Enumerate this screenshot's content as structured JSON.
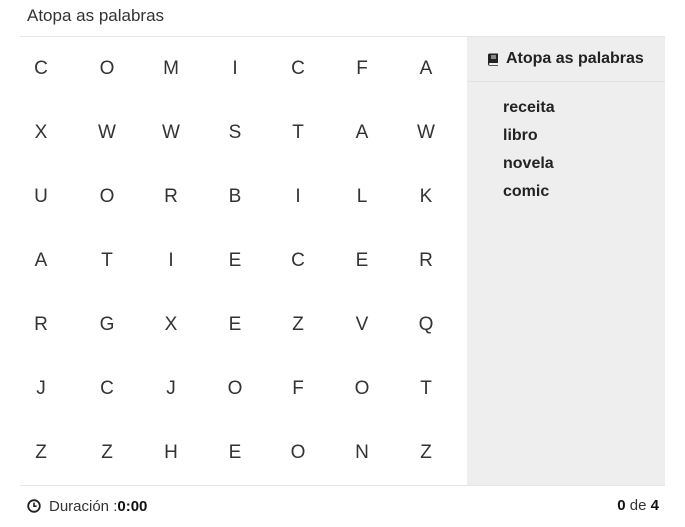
{
  "title": "Atopa as palabras",
  "grid": [
    [
      "C",
      "O",
      "M",
      "I",
      "C",
      "F",
      "A"
    ],
    [
      "X",
      "W",
      "W",
      "S",
      "T",
      "A",
      "W"
    ],
    [
      "U",
      "O",
      "R",
      "B",
      "I",
      "L",
      "K"
    ],
    [
      "A",
      "T",
      "I",
      "E",
      "C",
      "E",
      "R"
    ],
    [
      "R",
      "G",
      "X",
      "E",
      "Z",
      "V",
      "Q"
    ],
    [
      "J",
      "C",
      "J",
      "O",
      "F",
      "O",
      "T"
    ],
    [
      "Z",
      "Z",
      "H",
      "E",
      "O",
      "N",
      "Z"
    ]
  ],
  "word_panel": {
    "icon": "book-icon",
    "heading": "Atopa as palabras",
    "words": [
      "receita",
      "libro",
      "novela",
      "comic"
    ]
  },
  "footer": {
    "clock_icon": "clock-icon",
    "duration_label": "Duración : ",
    "duration_value": "0:00",
    "found_count": "0",
    "of_label": " de ",
    "total_count": "4"
  }
}
